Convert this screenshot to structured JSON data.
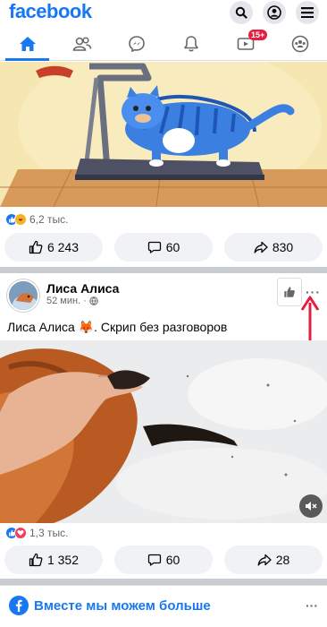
{
  "topbar": {
    "logo": "facebook",
    "search_icon": "search-icon",
    "profile_icon": "profile-icon",
    "menu_icon": "menu-icon"
  },
  "nav": {
    "tabs": [
      {
        "name": "home",
        "icon": "home-icon",
        "active": true
      },
      {
        "name": "friends",
        "icon": "friends-icon"
      },
      {
        "name": "messenger",
        "icon": "messenger-icon"
      },
      {
        "name": "notifications",
        "icon": "bell-icon"
      },
      {
        "name": "watch",
        "icon": "video-icon",
        "badge": "15+"
      },
      {
        "name": "groups",
        "icon": "groups-icon"
      }
    ]
  },
  "post1": {
    "reaction_count": "6,2 тыс.",
    "like_count": "6 243",
    "comment_count": "60",
    "share_count": "830"
  },
  "post2": {
    "author": "Лиса Алиса",
    "time": "52 мин.",
    "time_separator": "·",
    "caption": "Лиса Алиса 🦊. Скрип без разговоров",
    "reaction_count": "1,3 тыс.",
    "like_count": "1 352",
    "comment_count": "60",
    "share_count": "28",
    "more_label": "···"
  },
  "footer": {
    "text": "Вместе мы можем больше",
    "more_label": "···"
  },
  "colors": {
    "brand": "#1877f2",
    "annotation_arrow": "#e41e3f"
  }
}
